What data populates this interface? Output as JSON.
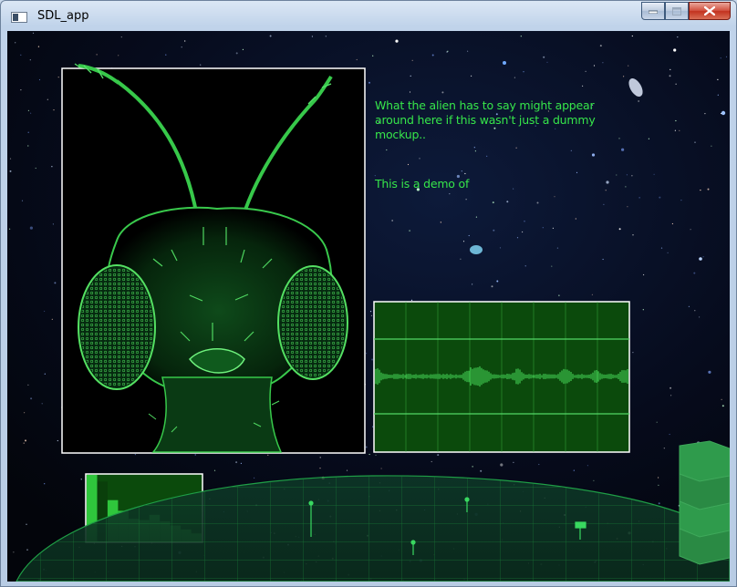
{
  "window": {
    "title": "SDL_app",
    "icon": "window-app-icon",
    "buttons": [
      "minimize-icon",
      "maximize-icon",
      "close-icon"
    ]
  },
  "alien_dialogue": {
    "lines": [
      "What the alien has to say might appear around here if this wasn't just a dummy mockup..",
      "This is a demo of"
    ]
  },
  "colors": {
    "text_green": "#36e64a",
    "panel_bg": "#0b4a0c",
    "grid_line": "#3fc24a",
    "panel_border": "#ffffff"
  },
  "waveform": {
    "icon": "audio-waveform"
  },
  "spectrum": {
    "icon": "audio-spectrum-histogram",
    "levels": [
      1.0,
      0.9,
      0.62,
      0.46,
      0.34,
      0.32,
      0.4,
      0.3,
      0.24,
      0.18,
      0.12
    ]
  }
}
